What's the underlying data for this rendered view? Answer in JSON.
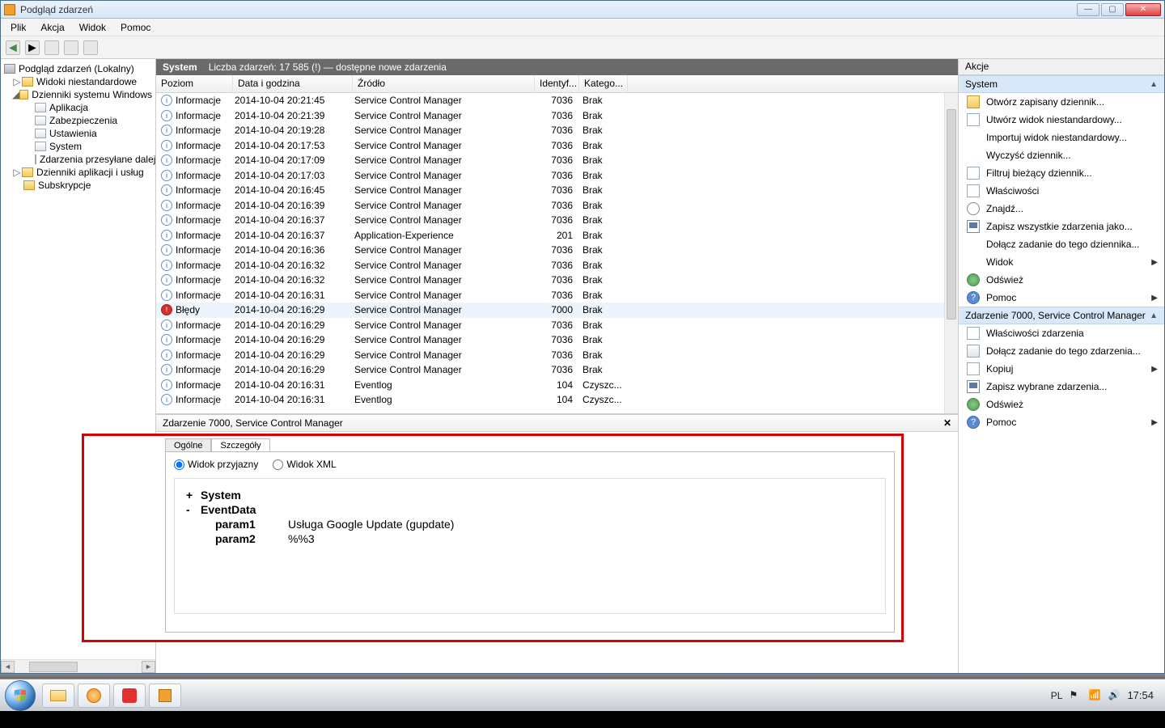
{
  "window": {
    "title": "Podgląd zdarzeń",
    "btn_min": "—",
    "btn_max": "▢",
    "btn_close": "✕"
  },
  "menu": {
    "file": "Plik",
    "action": "Akcja",
    "view": "Widok",
    "help": "Pomoc"
  },
  "tree": {
    "root": "Podgląd zdarzeń (Lokalny)",
    "custom": "Widoki niestandardowe",
    "winlogs": "Dzienniki systemu Windows",
    "app": "Aplikacja",
    "sec": "Zabezpieczenia",
    "setup": "Ustawienia",
    "system": "System",
    "fwd": "Zdarzenia przesyłane dalej",
    "appsvc": "Dzienniki aplikacji i usług",
    "subs": "Subskrypcje"
  },
  "midhdr": {
    "title": "System",
    "count_label": "Liczba zdarzeń: 17 585 (!) — dostępne nowe zdarzenia"
  },
  "cols": {
    "level": "Poziom",
    "date": "Data i godzina",
    "source": "Źródło",
    "id": "Identyf...",
    "cat": "Katego..."
  },
  "lvl": {
    "info": "Informacje",
    "err": "Błędy"
  },
  "events": [
    {
      "l": "info",
      "d": "2014-10-04 20:21:45",
      "s": "Service Control Manager",
      "i": "7036",
      "c": "Brak"
    },
    {
      "l": "info",
      "d": "2014-10-04 20:21:39",
      "s": "Service Control Manager",
      "i": "7036",
      "c": "Brak"
    },
    {
      "l": "info",
      "d": "2014-10-04 20:19:28",
      "s": "Service Control Manager",
      "i": "7036",
      "c": "Brak"
    },
    {
      "l": "info",
      "d": "2014-10-04 20:17:53",
      "s": "Service Control Manager",
      "i": "7036",
      "c": "Brak"
    },
    {
      "l": "info",
      "d": "2014-10-04 20:17:09",
      "s": "Service Control Manager",
      "i": "7036",
      "c": "Brak"
    },
    {
      "l": "info",
      "d": "2014-10-04 20:17:03",
      "s": "Service Control Manager",
      "i": "7036",
      "c": "Brak"
    },
    {
      "l": "info",
      "d": "2014-10-04 20:16:45",
      "s": "Service Control Manager",
      "i": "7036",
      "c": "Brak"
    },
    {
      "l": "info",
      "d": "2014-10-04 20:16:39",
      "s": "Service Control Manager",
      "i": "7036",
      "c": "Brak"
    },
    {
      "l": "info",
      "d": "2014-10-04 20:16:37",
      "s": "Service Control Manager",
      "i": "7036",
      "c": "Brak"
    },
    {
      "l": "info",
      "d": "2014-10-04 20:16:37",
      "s": "Application-Experience",
      "i": "201",
      "c": "Brak"
    },
    {
      "l": "info",
      "d": "2014-10-04 20:16:36",
      "s": "Service Control Manager",
      "i": "7036",
      "c": "Brak"
    },
    {
      "l": "info",
      "d": "2014-10-04 20:16:32",
      "s": "Service Control Manager",
      "i": "7036",
      "c": "Brak"
    },
    {
      "l": "info",
      "d": "2014-10-04 20:16:32",
      "s": "Service Control Manager",
      "i": "7036",
      "c": "Brak"
    },
    {
      "l": "info",
      "d": "2014-10-04 20:16:31",
      "s": "Service Control Manager",
      "i": "7036",
      "c": "Brak"
    },
    {
      "l": "err",
      "d": "2014-10-04 20:16:29",
      "s": "Service Control Manager",
      "i": "7000",
      "c": "Brak",
      "sel": true
    },
    {
      "l": "info",
      "d": "2014-10-04 20:16:29",
      "s": "Service Control Manager",
      "i": "7036",
      "c": "Brak"
    },
    {
      "l": "info",
      "d": "2014-10-04 20:16:29",
      "s": "Service Control Manager",
      "i": "7036",
      "c": "Brak"
    },
    {
      "l": "info",
      "d": "2014-10-04 20:16:29",
      "s": "Service Control Manager",
      "i": "7036",
      "c": "Brak"
    },
    {
      "l": "info",
      "d": "2014-10-04 20:16:29",
      "s": "Service Control Manager",
      "i": "7036",
      "c": "Brak"
    },
    {
      "l": "info",
      "d": "2014-10-04 20:16:31",
      "s": "Eventlog",
      "i": "104",
      "c": "Czyszc..."
    },
    {
      "l": "info",
      "d": "2014-10-04 20:16:31",
      "s": "Eventlog",
      "i": "104",
      "c": "Czyszc..."
    }
  ],
  "detail_title": "Zdarzenie 7000, Service Control Manager",
  "tabs": {
    "general": "Ogólne",
    "details": "Szczegóły"
  },
  "radios": {
    "friendly": "Widok przyjazny",
    "xml": "Widok XML"
  },
  "evt": {
    "system": "System",
    "eventdata": "EventData",
    "p1k": "param1",
    "p1v": "Usługa Google Update (gupdate)",
    "p2k": "param2",
    "p2v": "%%3"
  },
  "actions": {
    "title": "Akcje",
    "sec1": "System",
    "open_saved": "Otwórz zapisany dziennik...",
    "create_view": "Utwórz widok niestandardowy...",
    "import_view": "Importuj widok niestandardowy...",
    "clear_log": "Wyczyść dziennik...",
    "filter_log": "Filtruj bieżący dziennik...",
    "properties": "Właściwości",
    "find": "Znajdź...",
    "save_all": "Zapisz wszystkie zdarzenia jako...",
    "attach_task": "Dołącz zadanie do tego dziennika...",
    "view": "Widok",
    "refresh": "Odśwież",
    "help": "Pomoc",
    "sec2": "Zdarzenie 7000, Service Control Manager",
    "evt_props": "Właściwości zdarzenia",
    "evt_task": "Dołącz zadanie do tego zdarzenia...",
    "copy": "Kopiuj",
    "save_sel": "Zapisz wybrane zdarzenia...",
    "refresh2": "Odśwież",
    "help2": "Pomoc"
  },
  "taskbar": {
    "lang": "PL",
    "time": "17:54"
  }
}
